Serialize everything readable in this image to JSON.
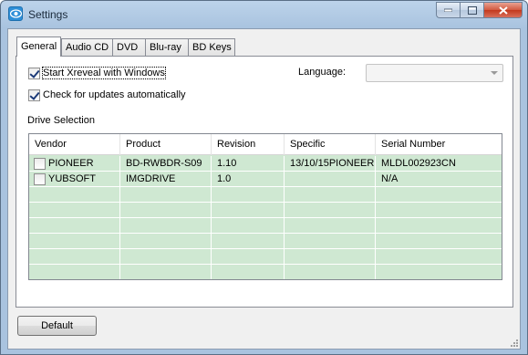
{
  "window": {
    "title": "Settings"
  },
  "tabs": [
    {
      "label": "General",
      "active": true
    },
    {
      "label": "Audio CD",
      "active": false
    },
    {
      "label": "DVD",
      "active": false
    },
    {
      "label": "Blu-ray",
      "active": false
    },
    {
      "label": "BD Keys",
      "active": false
    }
  ],
  "general": {
    "start_with_windows": {
      "label": "Start Xreveal with Windows",
      "checked": true
    },
    "check_updates": {
      "label": "Check for updates automatically",
      "checked": true
    },
    "language_label": "Language:",
    "language_value": "",
    "drive_section_label": "Drive Selection"
  },
  "drive_table": {
    "columns": [
      "Vendor",
      "Product",
      "Revision",
      "Specific",
      "Serial Number"
    ],
    "rows": [
      {
        "checked": false,
        "vendor": "PIONEER",
        "product": "BD-RWBDR-S09",
        "revision": "1.10",
        "specific": "13/10/15PIONEER",
        "serial": "MLDL002923CN"
      },
      {
        "checked": false,
        "vendor": "YUBSOFT",
        "product": "IMGDRIVE",
        "revision": "1.0",
        "specific": "",
        "serial": "N/A"
      }
    ]
  },
  "footer": {
    "default_label": "Default"
  },
  "colors": {
    "row_bg": "#cfe8d2",
    "accent": "#2e8fd8"
  },
  "icons": {
    "app": "eye-icon",
    "minimize": "minimize-icon",
    "maximize": "maximize-icon",
    "close": "close-icon"
  }
}
